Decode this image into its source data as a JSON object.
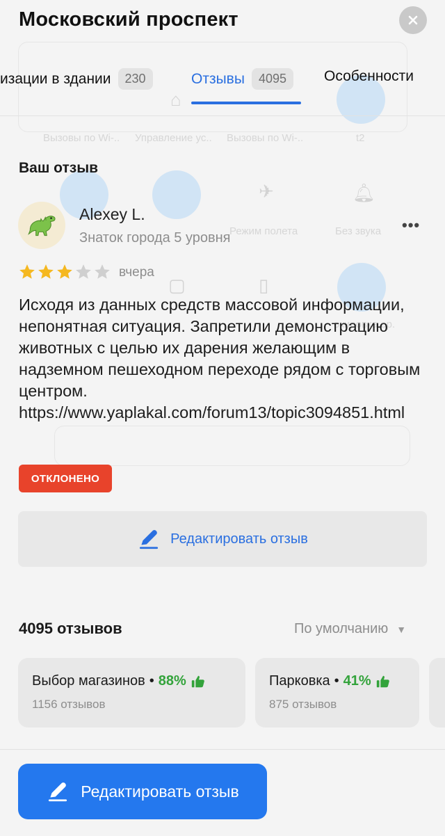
{
  "header": {
    "title": "Московский проспект"
  },
  "tabs": [
    {
      "label": "изации в здании",
      "count": "230"
    },
    {
      "label": "Отзывы",
      "count": "4095"
    },
    {
      "label": "Особенности",
      "count": ""
    }
  ],
  "own_review": {
    "section_title": "Ваш отзыв",
    "author": "Alexey L.",
    "author_level": "Знаток города 5 уровня",
    "rating": 3,
    "rating_max": 5,
    "date": "вчера",
    "text": "Исходя из данных средств массовой информации, непонятная ситуация. Запретили демонстрацию животных с целью их дарения желающим в надземном пешеходном переходе рядом с торговым центром. https://www.yaplakal.com/forum13/topic3094851.html",
    "status": "ОТКЛОНЕНО",
    "edit_label": "Редактировать отзыв",
    "more_label": "•••"
  },
  "reviews_list": {
    "count_title": "4095 отзывов",
    "sort_label": "По умолчанию"
  },
  "aspects": [
    {
      "name": "Выбор магазинов",
      "percent": "88%",
      "reviews": "1156 отзывов"
    },
    {
      "name": "Парковка",
      "percent": "41%",
      "reviews": "875 отзывов"
    }
  ],
  "bottom_button": {
    "label": "Редактировать отзыв"
  },
  "colors": {
    "accent": "#2a6fe0",
    "primary_button": "#2478ee",
    "star_filled": "#f5b820",
    "star_empty": "#cfcfcf",
    "positive": "#33a33b",
    "rejected": "#e8432b"
  }
}
